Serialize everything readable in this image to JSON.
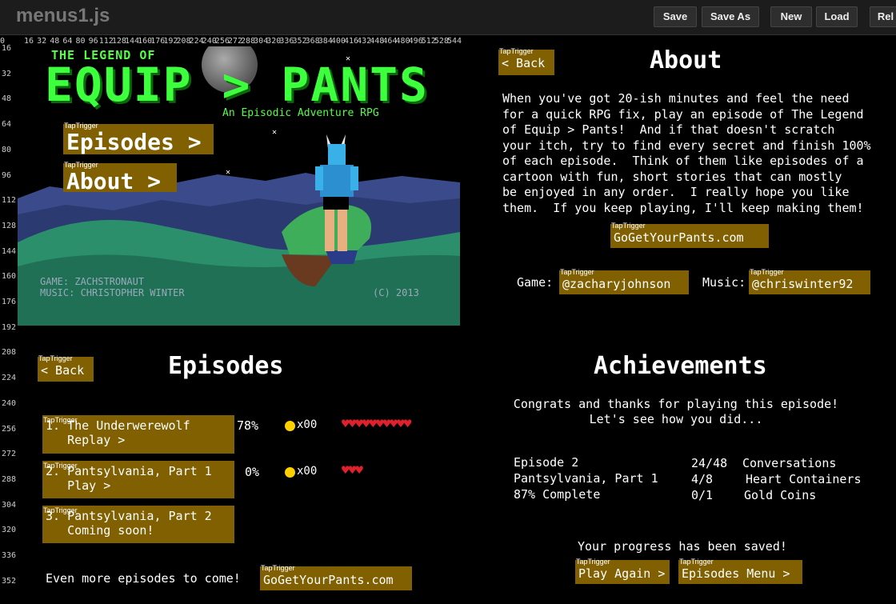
{
  "toolbar": {
    "title": "menus1.js",
    "buttons": {
      "save": "Save",
      "save_as": "Save As",
      "new": "New",
      "load": "Load",
      "rel": "Rel"
    }
  },
  "rulers": {
    "top": [
      "0",
      "16",
      "32",
      "48",
      "64",
      "80",
      "96",
      "112",
      "128",
      "144",
      "160",
      "176",
      "192",
      "208",
      "224",
      "240",
      "256",
      "272",
      "288",
      "304",
      "320",
      "336",
      "352",
      "368",
      "384",
      "400",
      "416",
      "432",
      "448",
      "464",
      "480",
      "496",
      "512",
      "528",
      "544"
    ],
    "left": [
      "16",
      "32",
      "48",
      "64",
      "80",
      "96",
      "112",
      "128",
      "144",
      "160",
      "176",
      "192",
      "208",
      "224",
      "240",
      "256",
      "272",
      "288",
      "304",
      "320",
      "336",
      "352"
    ]
  },
  "trigger_tag": "TapTrigger",
  "title_screen": {
    "legend_of": "THE LEGEND OF",
    "title": "EQUIP > PANTS",
    "subtitle": "An Episodic Adventure RPG",
    "credit_game": "GAME: ZACHSTRONAUT",
    "credit_music": "MUSIC: CHRISTOPHER WINTER",
    "copyright": "(C) 2013",
    "episodes_button": "Episodes >",
    "about_button": "About >"
  },
  "about": {
    "back": "< Back",
    "heading": "About",
    "text": "When you've got 20-ish minutes and feel the need\nfor a quick RPG fix, play an episode of The Legend\nof Equip > Pants!  And if that doesn't scratch\nyour itch, try to find every secret and finish 100%\nof each episode.  Think of them like episodes of a\ncartoon with fun, short stories that can mostly\nbe enjoyed in any order.  I really hope you like\nthem.  If you keep playing, I'll keep making them!",
    "website": "GoGetYourPants.com",
    "game_label": "Game:",
    "game_handle": "@zacharyjohnson",
    "music_label": "Music:",
    "music_handle": "@chriswinter92"
  },
  "episodes": {
    "back": "< Back",
    "heading": "Episodes",
    "list": [
      {
        "line1": "1. The Underwerewolf",
        "line2": "   Replay >",
        "percent": "78%",
        "coins": "x00",
        "hearts": "♥♥♥♥♥♥♥♥♥♥"
      },
      {
        "line1": "2. Pantsylvania, Part 1",
        "line2": "   Play >",
        "percent": "0%",
        "coins": "x00",
        "hearts": "♥♥♥"
      },
      {
        "line1": "3. Pantsylvania, Part 2",
        "line2": "   Coming soon!",
        "percent": "",
        "coins": "",
        "hearts": ""
      }
    ],
    "more": "Even more episodes to come!",
    "website": "GoGetYourPants.com"
  },
  "achievements": {
    "heading": "Achievements",
    "congrats": "Congrats and thanks for playing this episode!\nLet's see how you did...",
    "episode_number": "Episode 2",
    "episode_name": "Pantsylvania, Part 1",
    "complete": "87% Complete",
    "conversations_count": "24/48",
    "conversations_label": "Conversations",
    "hearts_count": "4/8",
    "hearts_label": "Heart Containers",
    "coins_count": "0/1",
    "coins_label": "Gold Coins",
    "saved": "Your progress has been saved!",
    "play_again": "Play Again >",
    "episodes_menu": "Episodes Menu >"
  },
  "colors": {
    "trigger": "#806000",
    "title_green": "#3dff3d",
    "heart": "#e0202c",
    "coin": "#ffd000"
  }
}
